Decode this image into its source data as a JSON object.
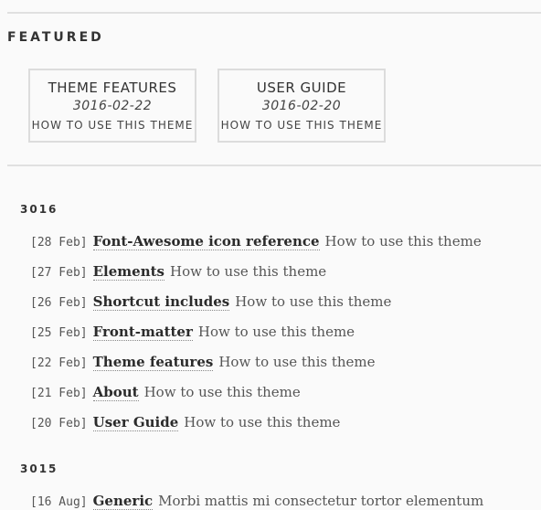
{
  "featured": {
    "heading": "FEATURED",
    "cards": [
      {
        "title": "THEME FEATURES",
        "date": "3016-02-22",
        "desc": "HOW TO USE THIS THEME"
      },
      {
        "title": "USER GUIDE",
        "date": "3016-02-20",
        "desc": "HOW TO USE THIS THEME"
      }
    ]
  },
  "archive": [
    {
      "year": "3016",
      "posts": [
        {
          "date": "[28 Feb]",
          "title": "Font-Awesome icon reference",
          "desc": "How to use this theme"
        },
        {
          "date": "[27 Feb]",
          "title": "Elements",
          "desc": "How to use this theme"
        },
        {
          "date": "[26 Feb]",
          "title": "Shortcut includes",
          "desc": "How to use this theme"
        },
        {
          "date": "[25 Feb]",
          "title": "Front-matter",
          "desc": "How to use this theme"
        },
        {
          "date": "[22 Feb]",
          "title": "Theme features",
          "desc": "How to use this theme"
        },
        {
          "date": "[21 Feb]",
          "title": "About",
          "desc": "How to use this theme"
        },
        {
          "date": "[20 Feb]",
          "title": "User Guide",
          "desc": "How to use this theme"
        }
      ]
    },
    {
      "year": "3015",
      "posts": [
        {
          "date": "[16 Aug]",
          "title": "Generic",
          "desc": "Morbi mattis mi consectetur tortor elementum"
        }
      ]
    }
  ]
}
